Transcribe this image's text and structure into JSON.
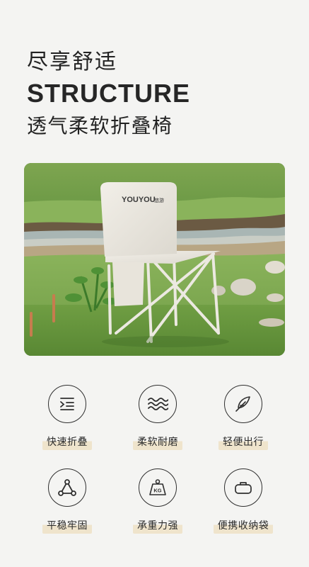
{
  "header": {
    "line1": "尽享舒适",
    "title": "STRUCTURE",
    "line2": "透气柔软折叠椅"
  },
  "photo": {
    "brand_text": "YOUYOU",
    "brand_small": "悠游"
  },
  "features": [
    {
      "label": "快速折叠",
      "icon": "list-indent-icon"
    },
    {
      "label": "柔软耐磨",
      "icon": "waves-icon"
    },
    {
      "label": "轻便出行",
      "icon": "feather-icon"
    },
    {
      "label": "平稳牢固",
      "icon": "triangle-nodes-icon"
    },
    {
      "label": "承重力强",
      "icon": "kg-weight-icon"
    },
    {
      "label": "便携收纳袋",
      "icon": "bag-icon"
    }
  ],
  "colors": {
    "background": "#f4f4f2",
    "label_highlight": "#efe4cc",
    "icon_stroke": "#2f2f2f"
  }
}
